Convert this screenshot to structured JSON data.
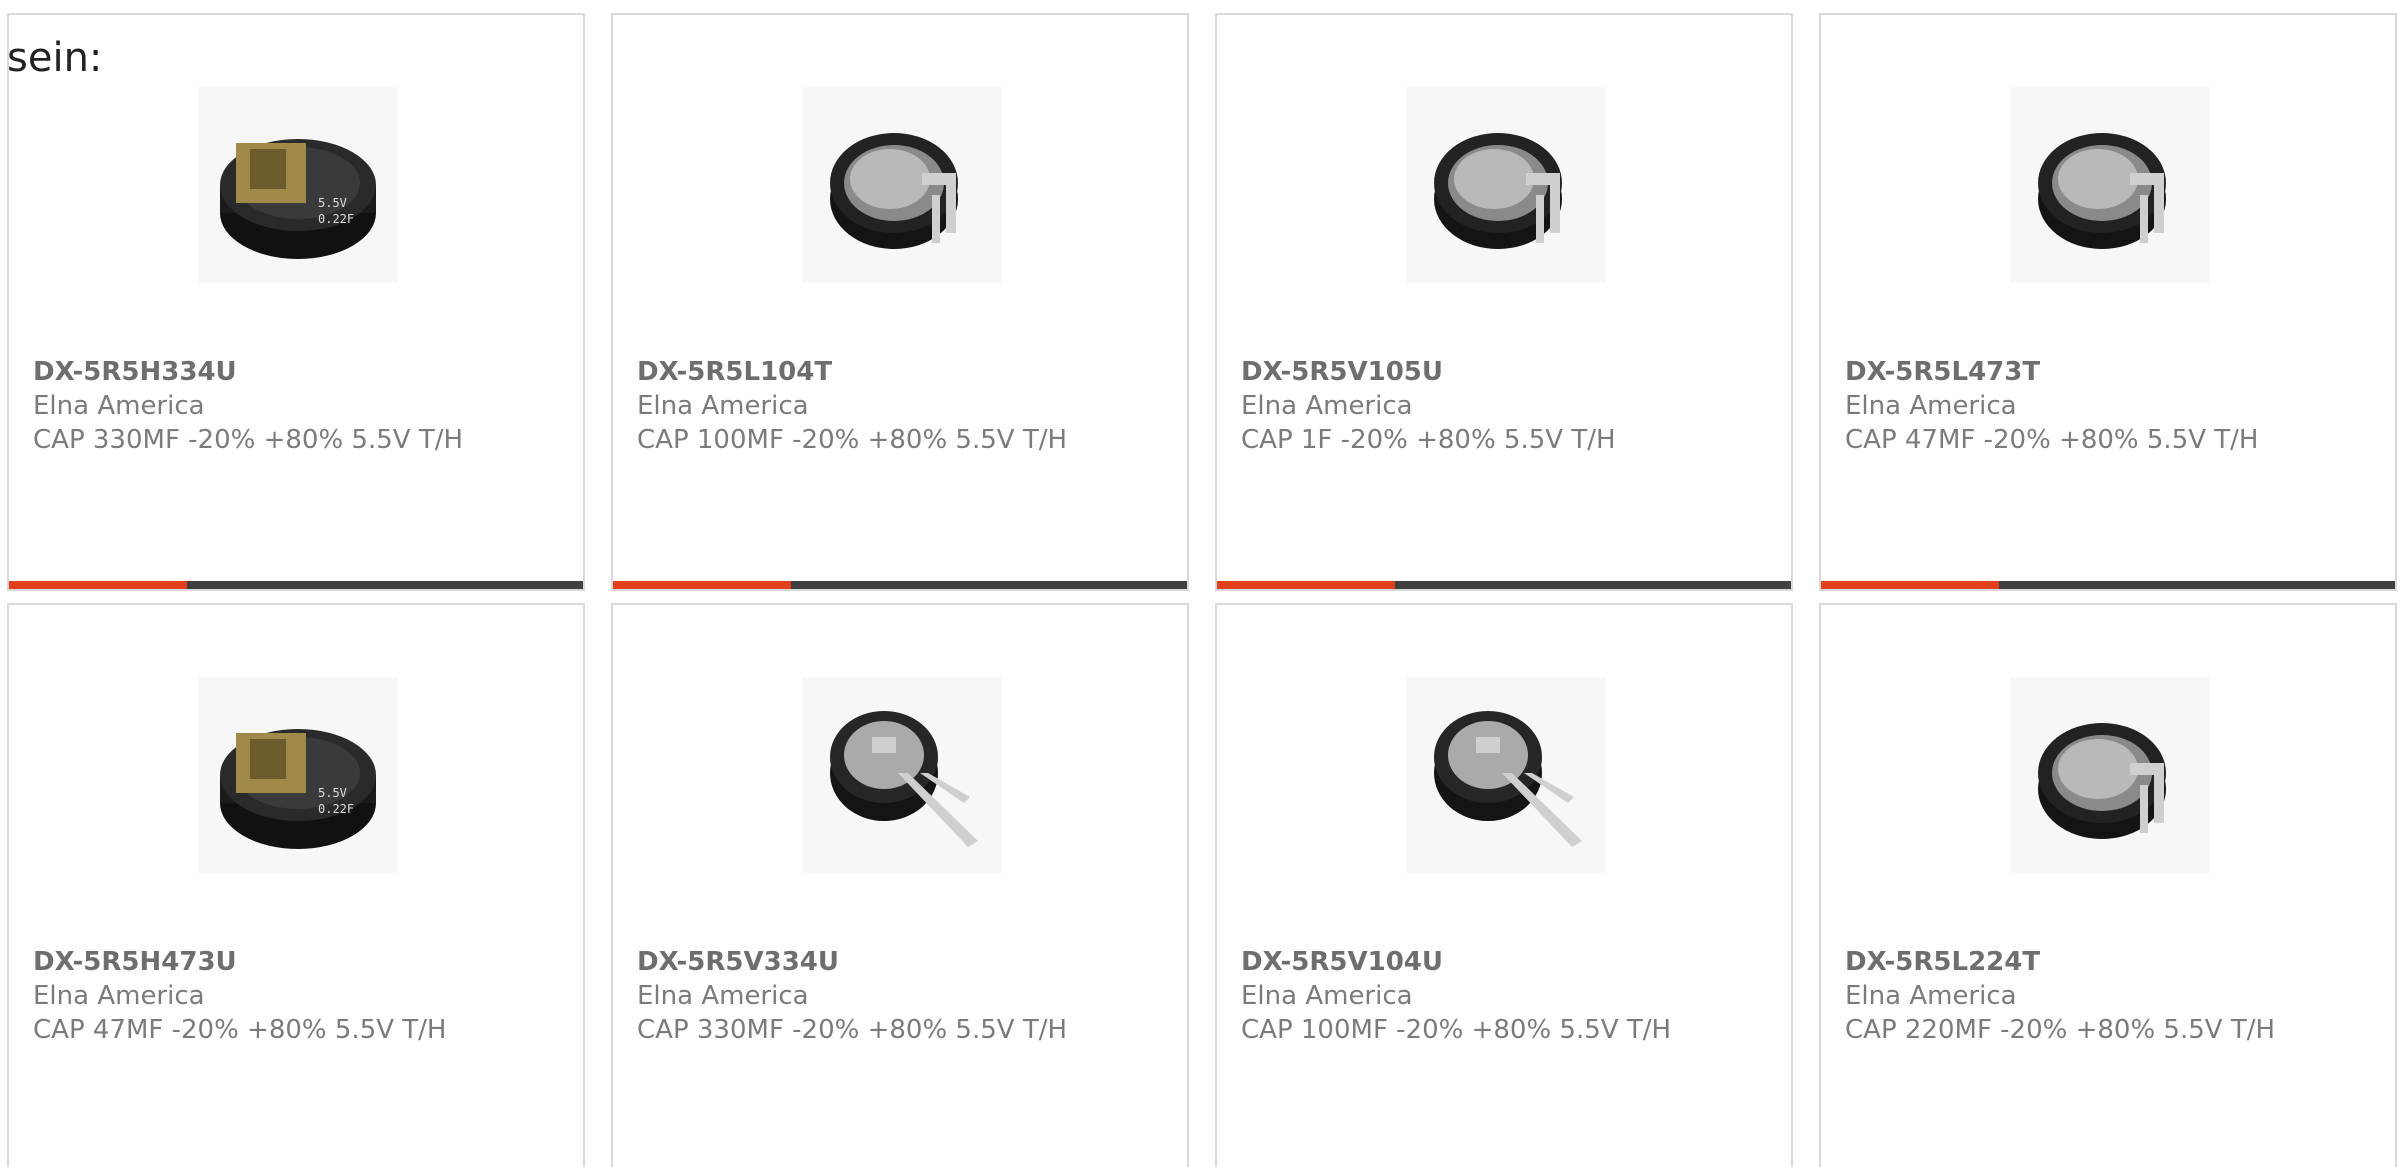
{
  "intro_text": "sein:",
  "colors": {
    "accent": "#e2401c",
    "bar_dark": "#3f3f3f",
    "card_border": "#d9d9d9"
  },
  "progress_fraction": 0.31,
  "cards": [
    {
      "part": "DX-5R5H334U",
      "maker": "Elna America",
      "desc": "CAP 330MF -20% +80% 5.5V T/H",
      "image": "capacitor-h-type-icon"
    },
    {
      "part": "DX-5R5L104T",
      "maker": "Elna America",
      "desc": "CAP 100MF -20% +80% 5.5V T/H",
      "image": "capacitor-l-type-icon"
    },
    {
      "part": "DX-5R5V105U",
      "maker": "Elna America",
      "desc": "CAP 1F -20% +80% 5.5V T/H",
      "image": "capacitor-l-type-icon"
    },
    {
      "part": "DX-5R5L473T",
      "maker": "Elna America",
      "desc": "CAP 47MF -20% +80% 5.5V T/H",
      "image": "capacitor-l-type-icon"
    },
    {
      "part": "DX-5R5H473U",
      "maker": "Elna America",
      "desc": "CAP 47MF -20% +80% 5.5V T/H",
      "image": "capacitor-h-type-icon"
    },
    {
      "part": "DX-5R5V334U",
      "maker": "Elna America",
      "desc": "CAP 330MF -20% +80% 5.5V T/H",
      "image": "capacitor-v-type-icon"
    },
    {
      "part": "DX-5R5V104U",
      "maker": "Elna America",
      "desc": "CAP 100MF -20% +80% 5.5V T/H",
      "image": "capacitor-v-type-icon"
    },
    {
      "part": "DX-5R5L224T",
      "maker": "Elna America",
      "desc": "CAP 220MF -20% +80% 5.5V T/H",
      "image": "capacitor-l-type-icon"
    }
  ]
}
